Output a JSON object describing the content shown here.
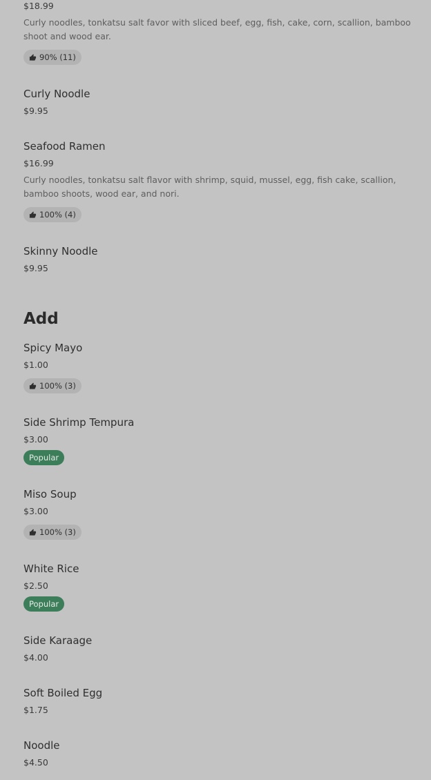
{
  "items_top": [
    {
      "price": "$18.99",
      "description": "Curly noodles, tonkatsu salt favor with sliced beef, egg, fish, cake, corn, scallion, bamboo shoot and wood ear.",
      "rating": "90% (11)"
    },
    {
      "name": "Curly Noodle",
      "price": "$9.95"
    },
    {
      "name": "Seafood Ramen",
      "price": "$16.99",
      "description": "Curly noodles, tonkatsu salt flavor with shrimp, squid, mussel, egg, fish cake, scallion, bamboo shoots, wood ear, and nori.",
      "rating": "100% (4)"
    },
    {
      "name": "Skinny Noodle",
      "price": "$9.95"
    }
  ],
  "add_section": {
    "title": "Add",
    "items": [
      {
        "name": "Spicy Mayo",
        "price": "$1.00",
        "rating": "100% (3)"
      },
      {
        "name": "Side Shrimp Tempura",
        "price": "$3.00",
        "badge": "Popular"
      },
      {
        "name": "Miso Soup",
        "price": "$3.00",
        "rating": "100% (3)"
      },
      {
        "name": "White Rice",
        "price": "$2.50",
        "badge": "Popular"
      },
      {
        "name": "Side Karaage",
        "price": "$4.00"
      },
      {
        "name": "Soft Boiled Egg",
        "price": "$1.75"
      },
      {
        "name": "Noodle",
        "price": "$4.50"
      }
    ]
  },
  "colors": {
    "background": "#c3c3c3",
    "popular_badge": "#3c7d5a",
    "rating_pill": "#b3b3b3"
  },
  "icons": {
    "rating": "thumbs-up-icon"
  }
}
